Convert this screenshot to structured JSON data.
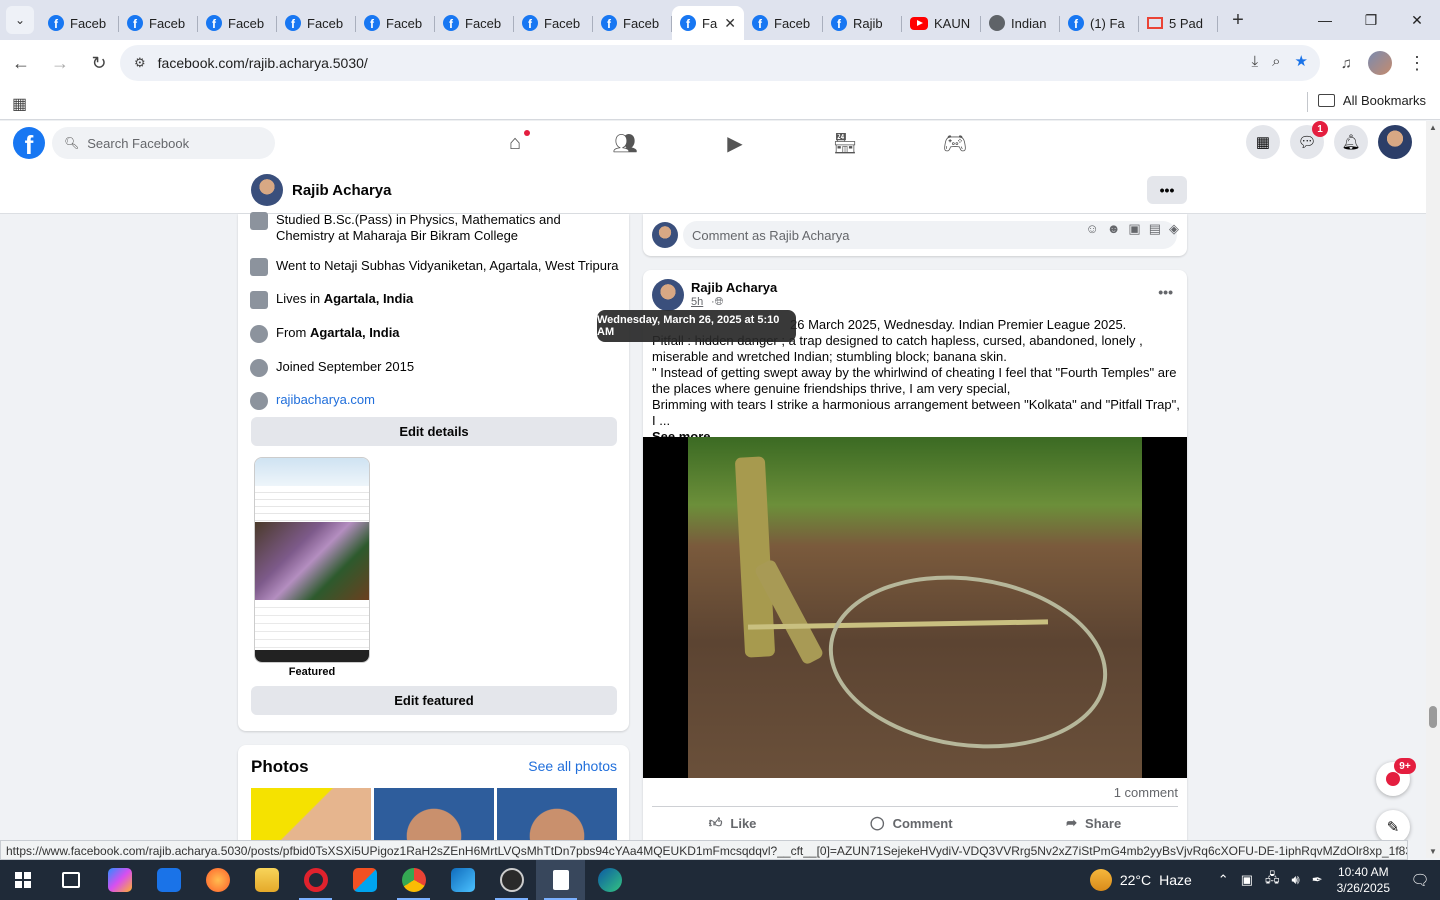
{
  "browser": {
    "tabs": [
      {
        "title": "Faceb",
        "icon": "facebook-icon"
      },
      {
        "title": "Faceb",
        "icon": "facebook-icon"
      },
      {
        "title": "Faceb",
        "icon": "facebook-icon"
      },
      {
        "title": "Faceb",
        "icon": "facebook-icon"
      },
      {
        "title": "Faceb",
        "icon": "facebook-icon"
      },
      {
        "title": "Faceb",
        "icon": "facebook-icon"
      },
      {
        "title": "Faceb",
        "icon": "facebook-icon"
      },
      {
        "title": "Faceb",
        "icon": "facebook-icon"
      },
      {
        "title": "Fa",
        "icon": "facebook-icon",
        "active": true
      },
      {
        "title": "Faceb",
        "icon": "facebook-icon"
      },
      {
        "title": "Rajib",
        "icon": "facebook-icon"
      },
      {
        "title": "KAUN",
        "icon": "youtube-icon"
      },
      {
        "title": "Indian",
        "icon": "globe-icon"
      },
      {
        "title": "(1) Fa",
        "icon": "facebook-icon"
      },
      {
        "title": "5 Pad",
        "icon": "gmail-icon"
      }
    ],
    "url": "facebook.com/rajib.acharya.5030/",
    "bookmarks_label": "All Bookmarks",
    "status_url": "https://www.facebook.com/rajib.acharya.5030/posts/pfbid0TsXSXi5UPigoz1RaH2sZEnH6MrtLVQsMhTtDn7pbs94cYAa4MQEUKD1mFmcsqdqvl?__cft__[0]=AZUN71SejekeHVydiV-VDQ3VVRrg5Nv2xZ7iStPmG4mb2yyBsVjvRq6cXOFU-DE-1iphRqvMZdOlr8xp_1f83cKfz..."
  },
  "facebook": {
    "search_placeholder": "Search Facebook",
    "messenger_badge": "1",
    "profile_name": "Rajib Acharya"
  },
  "intro": {
    "study": "Studied B.Sc.(Pass) in Physics, Mathematics and Chemistry at Maharaja Bir Bikram College",
    "school": "Went to Netaji Subhas Vidyaniketan, Agartala, West Tripura",
    "lives_prefix": "Lives in ",
    "lives_place": "Agartala, India",
    "from_prefix": "From ",
    "from_place": "Agartala, India",
    "joined": "Joined September 2015",
    "website": "rajibacharya.com",
    "edit_details": "Edit details",
    "featured_label": "Featured",
    "edit_featured": "Edit featured"
  },
  "photos": {
    "title": "Photos",
    "see_all": "See all photos"
  },
  "comment_box": {
    "placeholder": "Comment as Rajib Acharya"
  },
  "post": {
    "author": "Rajib Acharya",
    "time": "5h",
    "tooltip": "Wednesday, March 26, 2025 at 5:10 AM",
    "line1": "26 March 2025, Wednesday. Indian Premier League 2025.",
    "line2": "Pitfall : hidden danger ; a trap designed to catch hapless, cursed, abandoned, lonely , miserable and wretched Indian; stumbling block; banana skin.",
    "line3": "\" Instead of getting swept away by the whirlwind of cheating I feel that \"Fourth Temples\" are the places where genuine friendships thrive, I am very special,",
    "line4": "Brimming with tears I strike a harmonious arrangement between \"Kolkata\" and \"Pitfall Trap\", I ...",
    "see_more": "See more",
    "comment_count": "1 comment",
    "like": "Like",
    "comment": "Comment",
    "share": "Share"
  },
  "floating": {
    "news_badge": "9+"
  },
  "taskbar": {
    "temperature": "22°C",
    "weather": "Haze",
    "time": "10:40 AM",
    "date": "3/26/2025"
  }
}
